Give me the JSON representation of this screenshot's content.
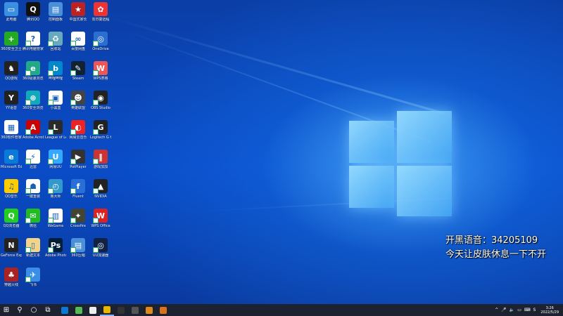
{
  "overlay": {
    "line1": "开黑语音：34205109",
    "line2": "今天让皮肤休息一下不开"
  },
  "desktop_icons": [
    {
      "label": "此电脑",
      "color": "#3b8fe0",
      "glyph": "▭"
    },
    {
      "label": "腾讯QQ",
      "color": "#111",
      "glyph": "Q"
    },
    {
      "label": "控制面板",
      "color": "#4a90d9",
      "glyph": "▤"
    },
    {
      "label": "中国式家长",
      "color": "#b22",
      "glyph": "★"
    },
    {
      "label": "向日葵远程",
      "color": "#e33",
      "glyph": "✿"
    },
    {
      "label": "360安全卫士",
      "color": "#2a2",
      "glyph": "+"
    },
    {
      "label": "腾讯电脑管家",
      "color": "#fff",
      "glyph": "?"
    },
    {
      "label": "回收站",
      "color": "#6ab",
      "glyph": "♻"
    },
    {
      "label": "百度网盘",
      "color": "#fff",
      "glyph": "∞"
    },
    {
      "label": "OneDrive",
      "color": "#2b6fd1",
      "glyph": "◎"
    },
    {
      "label": "QQ游戏",
      "color": "#222",
      "glyph": "♞"
    },
    {
      "label": "360极速浏览器",
      "color": "#2a8",
      "glyph": "e"
    },
    {
      "label": "哔哩哔哩",
      "color": "#08c",
      "glyph": "b"
    },
    {
      "label": "Steam",
      "color": "#123",
      "glyph": "✎"
    },
    {
      "label": "WPS表格",
      "color": "#e55",
      "glyph": "W"
    },
    {
      "label": "YY语音",
      "color": "#222",
      "glyph": "Y"
    },
    {
      "label": "360安全浏览器",
      "color": "#1ab",
      "glyph": "⊕"
    },
    {
      "label": "小黑盒",
      "color": "#fff",
      "glyph": "▣"
    },
    {
      "label": "英雄联盟",
      "color": "#444",
      "glyph": "☻"
    },
    {
      "label": "OBS Studio",
      "color": "#222",
      "glyph": "◉"
    },
    {
      "label": "360软件管家",
      "color": "#fff",
      "glyph": "▦"
    },
    {
      "label": "Adobe Acrobat",
      "color": "#c00",
      "glyph": "A"
    },
    {
      "label": "League of Legends",
      "color": "#2a2a2a",
      "glyph": "L"
    },
    {
      "label": "网易云音乐",
      "color": "#e22",
      "glyph": "◐"
    },
    {
      "label": "Logitech G HUB",
      "color": "#222",
      "glyph": "G"
    },
    {
      "label": "Microsoft Edge",
      "color": "#0a7ad8",
      "glyph": "e"
    },
    {
      "label": "迅雷",
      "color": "#fff",
      "glyph": "⚡"
    },
    {
      "label": "网易UU",
      "color": "#3af",
      "glyph": "U"
    },
    {
      "label": "PotPlayer",
      "color": "#333",
      "glyph": "▶"
    },
    {
      "label": "游戏加加",
      "color": "#c33",
      "glyph": "‖"
    },
    {
      "label": "QQ音乐",
      "color": "#fc0",
      "glyph": "♫"
    },
    {
      "label": "一键重装",
      "color": "#fff",
      "glyph": "☗"
    },
    {
      "label": "鲁大师",
      "color": "#39c",
      "glyph": "◴"
    },
    {
      "label": "Fluent",
      "color": "#2a6ed8",
      "glyph": "f"
    },
    {
      "label": "NVIDIA",
      "color": "#222",
      "glyph": "▲"
    },
    {
      "label": "QQ浏览器",
      "color": "#2c2",
      "glyph": "Q"
    },
    {
      "label": "微信",
      "color": "#2b2",
      "glyph": "✉"
    },
    {
      "label": "WeGame",
      "color": "#fff",
      "glyph": "▥"
    },
    {
      "label": "Crossfire",
      "color": "#443",
      "glyph": "✦"
    },
    {
      "label": "WPS Office",
      "color": "#d22",
      "glyph": "W"
    },
    {
      "label": "GeForce Experience",
      "color": "#222",
      "glyph": "N"
    },
    {
      "label": "新建文本",
      "color": "#f2d488",
      "glyph": "▯"
    },
    {
      "label": "Adobe Photoshop",
      "color": "#001e36",
      "glyph": "Ps"
    },
    {
      "label": "360压缩",
      "color": "#4a90d9",
      "glyph": "▤"
    },
    {
      "label": "UU加速器",
      "color": "#124",
      "glyph": "◎"
    },
    {
      "label": "穿越火线",
      "color": "#a22",
      "glyph": "♣"
    },
    {
      "label": "飞书",
      "color": "#3a8ee6",
      "glyph": "✈"
    }
  ],
  "taskbar": {
    "start_glyph": "⊞",
    "search_glyph": "⚲",
    "cortana_glyph": "○",
    "taskview_glyph": "⧉",
    "apps": [
      {
        "color": "#0a7ad8"
      },
      {
        "color": "#5b5"
      },
      {
        "color": "#eee"
      },
      {
        "color": "#e6b800"
      },
      {
        "color": "#333"
      },
      {
        "color": "#555"
      },
      {
        "color": "#e08a1e"
      },
      {
        "color": "#d9721a"
      }
    ],
    "tray_icons": [
      "^",
      "🎤",
      "🔈",
      "▭",
      "⌨",
      "S"
    ],
    "time": "3:26",
    "date": "2022/5/29"
  }
}
